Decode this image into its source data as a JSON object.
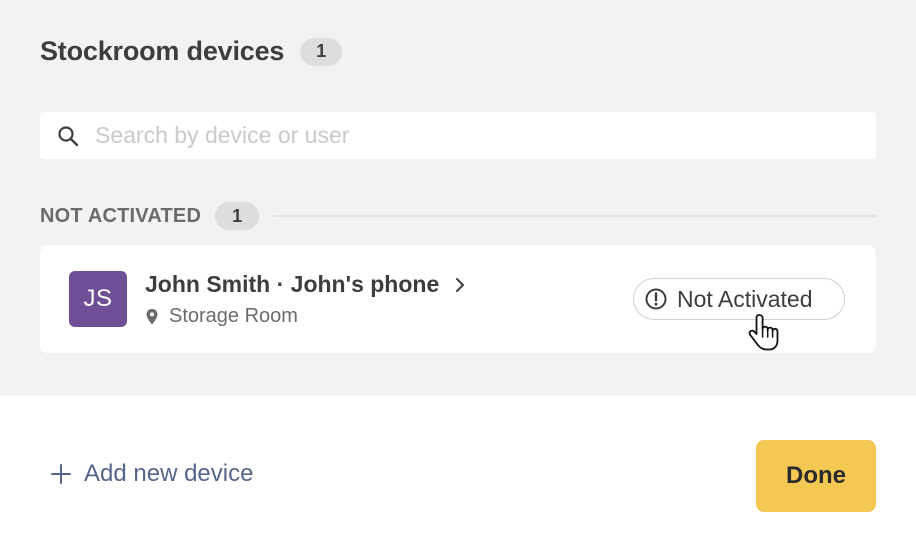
{
  "header": {
    "title": "Stockroom devices",
    "count": "1"
  },
  "search": {
    "placeholder": "Search by device or user",
    "value": ""
  },
  "section": {
    "label": "NOT ACTIVATED",
    "count": "1"
  },
  "device": {
    "avatar_initials": "JS",
    "avatar_color": "#6e4f96",
    "name": "John Smith · John's phone",
    "location": "Storage Room",
    "status": "Not Activated"
  },
  "footer": {
    "add_label": "Add new device",
    "done_label": "Done",
    "done_color": "#f5c853"
  },
  "icons": {
    "search": "search-icon",
    "chevron": "chevron-right-icon",
    "location": "map-pin-icon",
    "status": "alert-circle-icon",
    "add": "plus-icon",
    "cursor": "hand-pointer-cursor-icon"
  }
}
